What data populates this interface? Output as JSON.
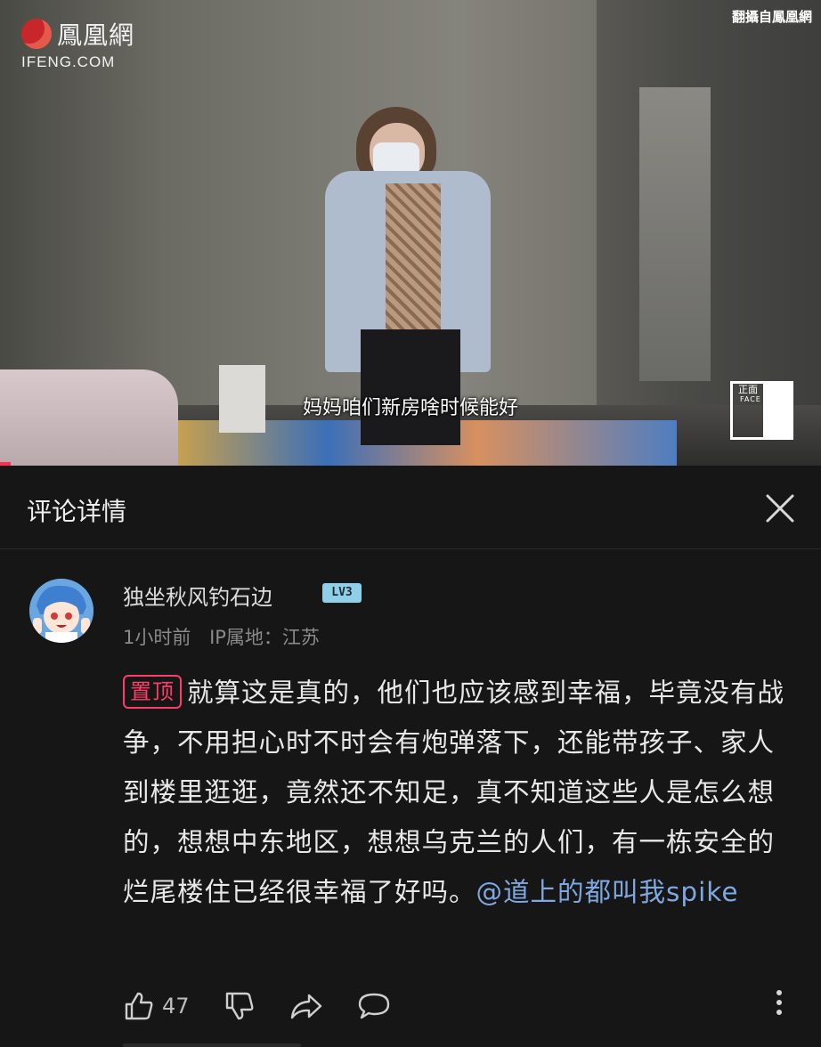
{
  "video": {
    "logo_cn": "鳳凰網",
    "logo_en": "IFENG.COM",
    "source_note": "翻攝自鳳凰網",
    "subtitle": "妈妈咱们新房啥时候能好",
    "watermark_cn": "正面",
    "watermark_en": "FACE"
  },
  "panel": {
    "title": "评论详情",
    "close_icon": "close-icon"
  },
  "comment": {
    "username": "独坐秋风钓石边",
    "level": "LV3",
    "time": "1小时前",
    "ip_location": "IP属地：江苏",
    "pin_label": "置顶",
    "text": "就算这是真的，他们也应该感到幸福，毕竟没有战争，不用担心时不时会有炮弹落下，还能带孩子、家人到楼里逛逛，竟然还不知足，真不知道这些人是怎么想的，想想中东地区，想想乌克兰的人们，有一栋安全的烂尾楼住已经很幸福了好吗。",
    "mention": "@道上的都叫我spike",
    "likes": "47"
  },
  "actions": {
    "icons": [
      "thumbs-up-icon",
      "thumbs-down-icon",
      "share-icon",
      "reply-icon",
      "more-icon"
    ]
  },
  "colors": {
    "background": "#161616",
    "pin": "#ff3b6a",
    "mention": "#7fa8e0",
    "level_badge": "#8fd0e8",
    "progress": "#ff2c55"
  }
}
